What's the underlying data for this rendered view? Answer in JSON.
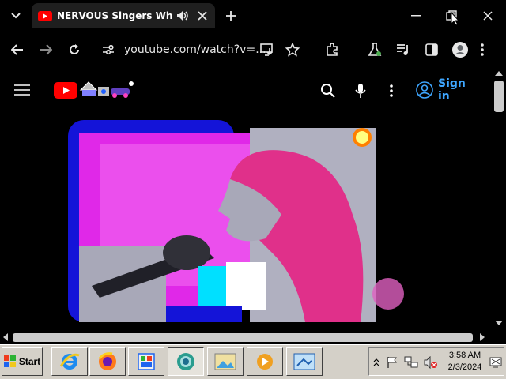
{
  "browser": {
    "tab_title": "NERVOUS Singers Who SH",
    "url": "youtube.com/watch?v=..."
  },
  "youtube": {
    "sign_in_label": "Sign in"
  },
  "taskbar": {
    "start_label": "Start",
    "clock_time": "3:58 AM",
    "clock_date": "2/3/2024"
  },
  "colors": {
    "youtube_red": "#ff0000",
    "link_blue": "#3ea6ff",
    "taskbar_gray": "#d4d0c8"
  }
}
